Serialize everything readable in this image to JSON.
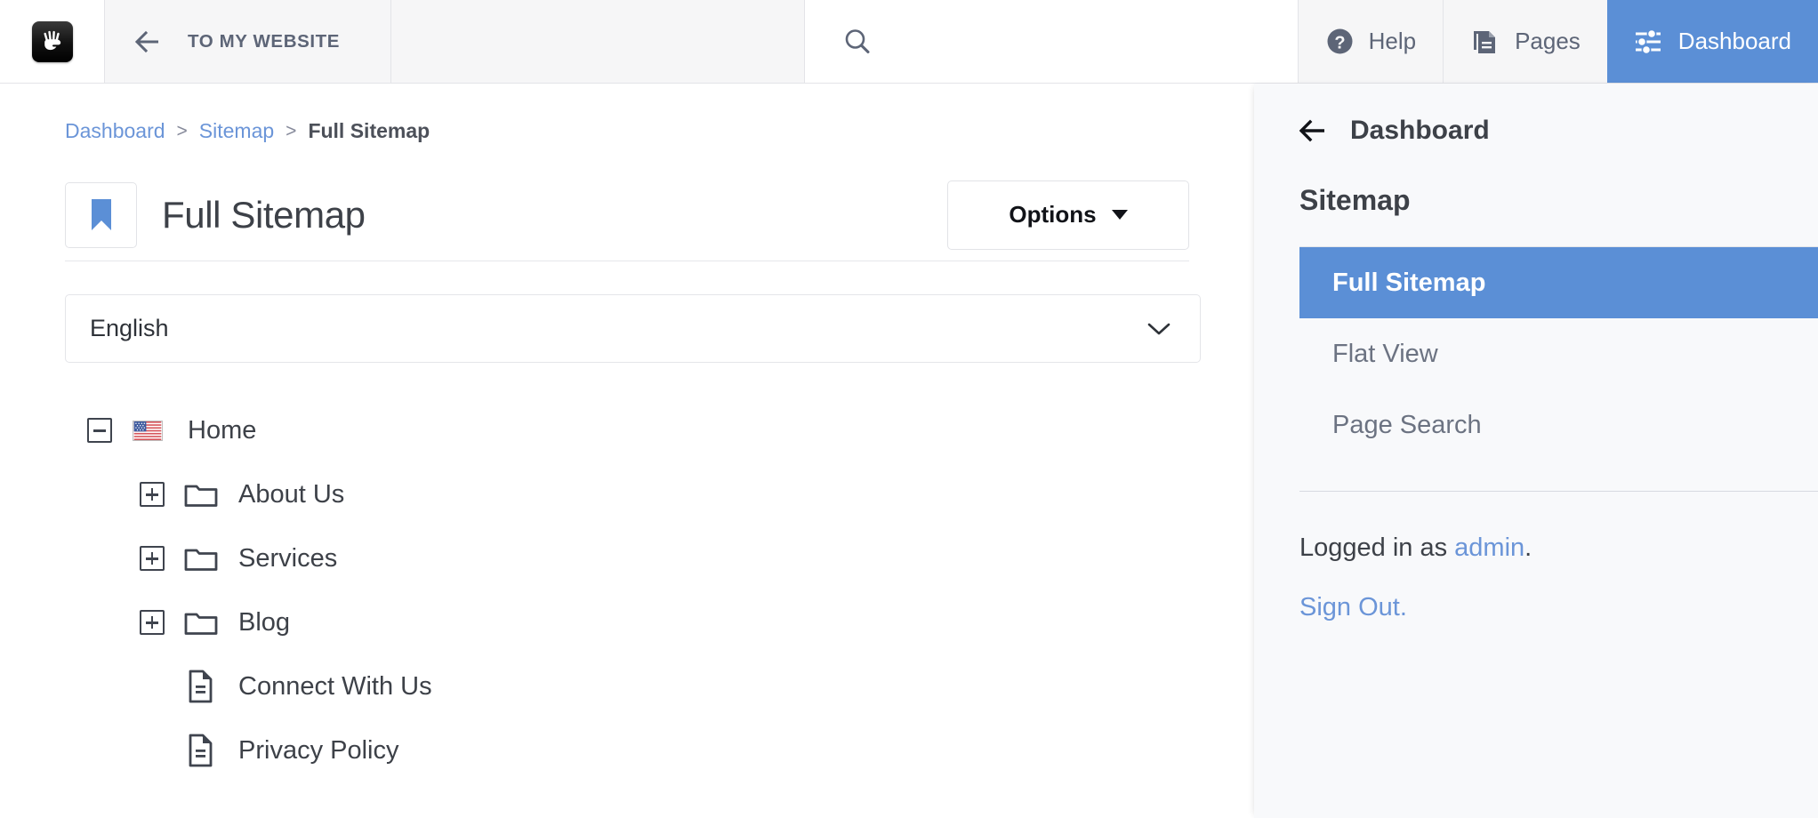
{
  "topbar": {
    "logo_icon": "concrete5-hand-logo-icon",
    "to_website": {
      "label": "TO MY WEBSITE",
      "icon": "arrow-left-icon"
    },
    "search": {
      "icon": "search-icon",
      "placeholder": ""
    },
    "nav": [
      {
        "label": "Help",
        "icon": "question-circle-icon",
        "active": false
      },
      {
        "label": "Pages",
        "icon": "pages-icon",
        "active": false
      },
      {
        "label": "Dashboard",
        "icon": "sliders-icon",
        "active": true
      }
    ]
  },
  "breadcrumb": {
    "items": [
      {
        "label": "Dashboard",
        "link": true
      },
      {
        "label": "Sitemap",
        "link": true
      },
      {
        "label": "Full Sitemap",
        "link": false
      }
    ],
    "separator": ">"
  },
  "page": {
    "icon": "bookmark-icon",
    "title": "Full Sitemap",
    "options_button": "Options"
  },
  "language": {
    "selected": "English",
    "icon": "chevron-down-icon"
  },
  "tree": {
    "nodes": [
      {
        "label": "Home",
        "indent": 0,
        "toggle": "minus",
        "icon": "flag-us-icon"
      },
      {
        "label": "About Us",
        "indent": 1,
        "toggle": "plus",
        "icon": "folder-icon"
      },
      {
        "label": "Services",
        "indent": 1,
        "toggle": "plus",
        "icon": "folder-icon"
      },
      {
        "label": "Blog",
        "indent": 1,
        "toggle": "plus",
        "icon": "folder-icon"
      },
      {
        "label": "Connect With Us",
        "indent": 1,
        "toggle": "none",
        "icon": "page-icon"
      },
      {
        "label": "Privacy Policy",
        "indent": 1,
        "toggle": "none",
        "icon": "page-icon"
      }
    ]
  },
  "sidebar": {
    "back": {
      "label": "Dashboard",
      "icon": "arrow-left-icon"
    },
    "section_title": "Sitemap",
    "items": [
      {
        "label": "Full Sitemap",
        "active": true
      },
      {
        "label": "Flat View",
        "active": false
      },
      {
        "label": "Page Search",
        "active": false
      }
    ],
    "logged_in_prefix": "Logged in as ",
    "logged_in_user": "admin",
    "logged_in_suffix": ".",
    "sign_out": "Sign Out."
  },
  "colors": {
    "accent": "#5b8fd6",
    "link": "#6b95d8",
    "text": "#3d4148",
    "muted": "#6c7382",
    "sidebar_bg": "#f8f9fb",
    "topbar_bg": "#f6f6f7"
  }
}
